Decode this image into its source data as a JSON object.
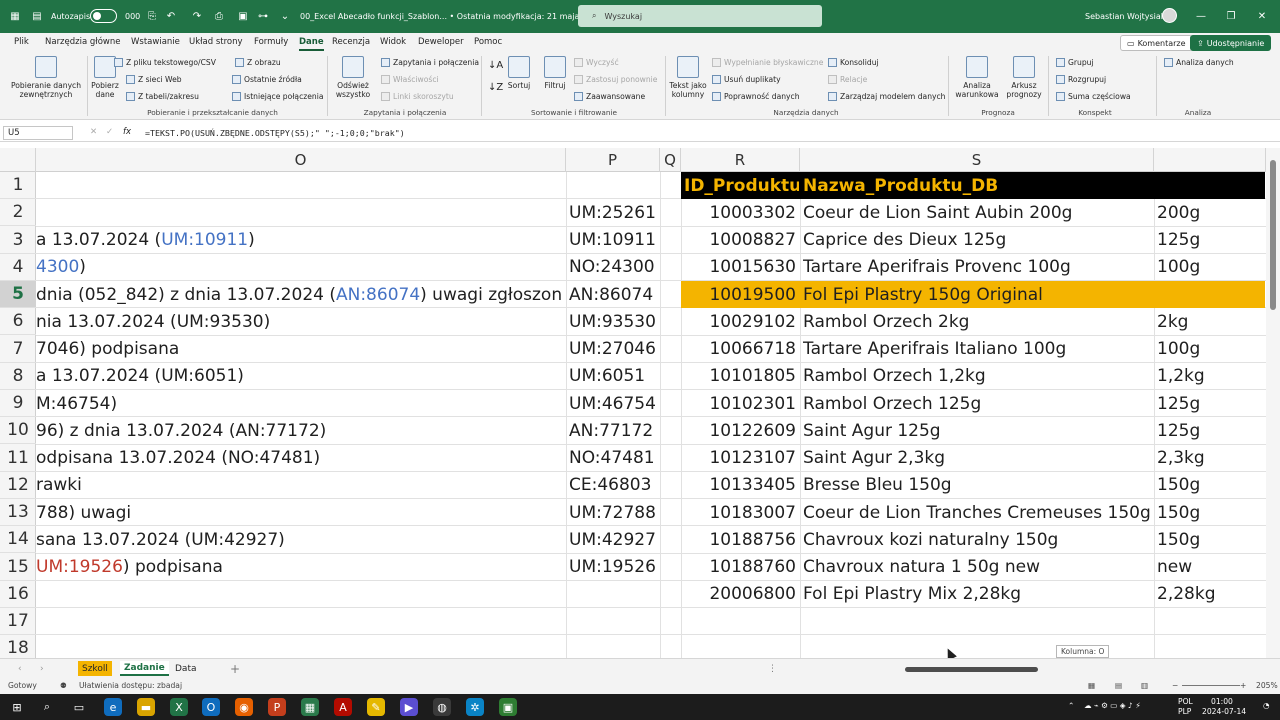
{
  "titlebar": {
    "autosave_label": "Autozapis",
    "file_title": "00_Excel Abecadło funkcji_Szablon... • Ostatnia modyfikacja: 21 maja",
    "search_placeholder": "Wyszukaj",
    "user_name": "Sebastian Wojtysiak",
    "dots": "000"
  },
  "ribbon_tabs": [
    "Plik",
    "Narzędzia główne",
    "Wstawianie",
    "Układ strony",
    "Formuły",
    "Dane",
    "Recenzja",
    "Widok",
    "Deweloper",
    "Pomoc"
  ],
  "ribbon_buttons": {
    "comments": "Komentarze",
    "share": "Udostępnianie"
  },
  "ribbon": {
    "get_data": "Pobieranie danych zewnętrznych",
    "pobierz_dane": "Pobierz dane",
    "from_text": "Z pliku tekstowego/CSV",
    "from_web": "Z sieci Web",
    "from_table": "Z tabeli/zakresu",
    "from_picture": "Z obrazu",
    "recent_sources": "Ostatnie źródła",
    "existing_connections": "Istniejące połączenia",
    "group1": "Pobieranie i przekształcanie danych",
    "refresh_all": "Odśwież wszystko",
    "queries_connections": "Zapytania i połączenia",
    "properties": "Właściwości",
    "edit_links": "Linki skoroszytu",
    "group2": "Zapytania i połączenia",
    "sort": "Sortuj",
    "filter": "Filtruj",
    "clear": "Wyczyść",
    "reapply": "Zastosuj ponownie",
    "advanced": "Zaawansowane",
    "group3": "Sortowanie i filtrowanie",
    "text_to_columns": "Tekst jako kolumny",
    "flash_fill": "Wypełnianie błyskawiczne",
    "remove_duplicates": "Usuń duplikaty",
    "data_validation": "Poprawność danych",
    "consolidate": "Konsoliduj",
    "relationships": "Relacje",
    "data_model": "Zarządzaj modelem danych",
    "group4": "Narzędzia danych",
    "what_if": "Analiza warunkowa",
    "forecast_sheet": "Arkusz prognozy",
    "group5": "Prognoza",
    "group_btn": "Grupuj",
    "ungroup_btn": "Rozgrupuj",
    "subtotal": "Suma częściowa",
    "group6": "Konspekt",
    "data_analysis": "Analiza danych",
    "group7": "Analiza"
  },
  "formula_bar": {
    "name_box": "U5",
    "fx": "fx",
    "formula": "=TEKST.PO(USUŃ.ZBĘDNE.ODSTĘPY(S5);\" \";-1;0;0;\"brak\")"
  },
  "columns": [
    "O",
    "P",
    "Q",
    "R",
    "S"
  ],
  "rows": [
    "1",
    "2",
    "3",
    "4",
    "5",
    "6",
    "7",
    "8",
    "9",
    "10",
    "11",
    "12",
    "13",
    "14",
    "15",
    "16",
    "17",
    "18"
  ],
  "header_row": {
    "r": "ID_Produktu",
    "s": "Nazwa_Produktu_DB"
  },
  "col_o": [
    {
      "pre": "",
      "link": "",
      "post": ""
    },
    {
      "pre": "",
      "link": "",
      "post": ""
    },
    {
      "pre": "a 13.07.2024 (",
      "link": "UM:10911",
      "post": ")"
    },
    {
      "pre": "",
      "link": "4300",
      "post": ")"
    },
    {
      "pre": "dnia (052_842) z dnia 13.07.2024 (",
      "link": "AN:86074",
      "post": ") uwagi zgłoszone"
    },
    {
      "pre": "nia 13.07.2024 (UM:93530)",
      "link": "",
      "post": ""
    },
    {
      "pre": "7046) podpisana",
      "link": "",
      "post": ""
    },
    {
      "pre": "a 13.07.2024 (UM:6051)",
      "link": "",
      "post": ""
    },
    {
      "pre": "M:46754)",
      "link": "",
      "post": ""
    },
    {
      "pre": "96) z dnia 13.07.2024 (AN:77172)",
      "link": "",
      "post": ""
    },
    {
      "pre": "odpisana 13.07.2024 (NO:47481)",
      "link": "",
      "post": ""
    },
    {
      "pre": "rawki",
      "link": "",
      "post": ""
    },
    {
      "pre": "788) uwagi",
      "link": "",
      "post": ""
    },
    {
      "pre": "sana 13.07.2024 (UM:42927)",
      "link": "",
      "post": ""
    },
    {
      "pre": "",
      "red": "UM:19526",
      "post": ") podpisana"
    }
  ],
  "col_p": [
    "",
    "UM:25261",
    "UM:10911",
    "NO:24300",
    "AN:86074",
    "UM:93530",
    "UM:27046",
    "UM:6051",
    "UM:46754",
    "AN:77172",
    "NO:47481",
    "CE:46803",
    "UM:72788",
    "UM:42927",
    "UM:19526"
  ],
  "products": [
    {
      "id": "10003302",
      "name": "Coeur de Lion Saint Aubin 200g",
      "unit": "200g"
    },
    {
      "id": "10008827",
      "name": "Caprice des Dieux 125g",
      "unit": "125g"
    },
    {
      "id": "10015630",
      "name": "Tartare Aperifrais Provenc 100g",
      "unit": "100g"
    },
    {
      "id": "10019500",
      "name": "Fol Epi Plastry 150g Original",
      "unit": ""
    },
    {
      "id": "10029102",
      "name": "Rambol Orzech 2kg",
      "unit": "2kg"
    },
    {
      "id": "10066718",
      "name": "Tartare Aperifrais Italiano 100g",
      "unit": "100g"
    },
    {
      "id": "10101805",
      "name": "Rambol Orzech 1,2kg",
      "unit": "1,2kg"
    },
    {
      "id": "10102301",
      "name": "Rambol Orzech 125g",
      "unit": "125g"
    },
    {
      "id": "10122609",
      "name": "Saint Agur 125g",
      "unit": "125g"
    },
    {
      "id": "10123107",
      "name": "Saint Agur 2,3kg",
      "unit": "2,3kg"
    },
    {
      "id": "10133405",
      "name": "Bresse Bleu 150g",
      "unit": "150g"
    },
    {
      "id": "10183007",
      "name": "Coeur de Lion Tranches Cremeuses 150g",
      "unit": "150g"
    },
    {
      "id": "10188756",
      "name": "Chavroux kozi naturalny 150g",
      "unit": "150g"
    },
    {
      "id": "10188760",
      "name": "Chavroux natura 1 50g new",
      "unit": "new"
    },
    {
      "id": "20006800",
      "name": "Fol Epi Plastry Mix 2,28kg",
      "unit": "2,28kg"
    }
  ],
  "sheets": [
    "Szkoll",
    "Zadanie",
    "Data"
  ],
  "tooltip": "Kolumna: O",
  "status": {
    "ready": "Gotowy",
    "accessibility": "Ułatwienia dostępu: zbadaj",
    "zoom": "205%"
  },
  "taskbar": {
    "lang1": "POL",
    "lang2": "PLP",
    "time": "01:00",
    "date": "2024-07-14"
  },
  "colors": {
    "excel_green": "#217346",
    "accent_orange": "#f4b400",
    "link_blue": "#4472c4",
    "error_red": "#c0392b"
  }
}
